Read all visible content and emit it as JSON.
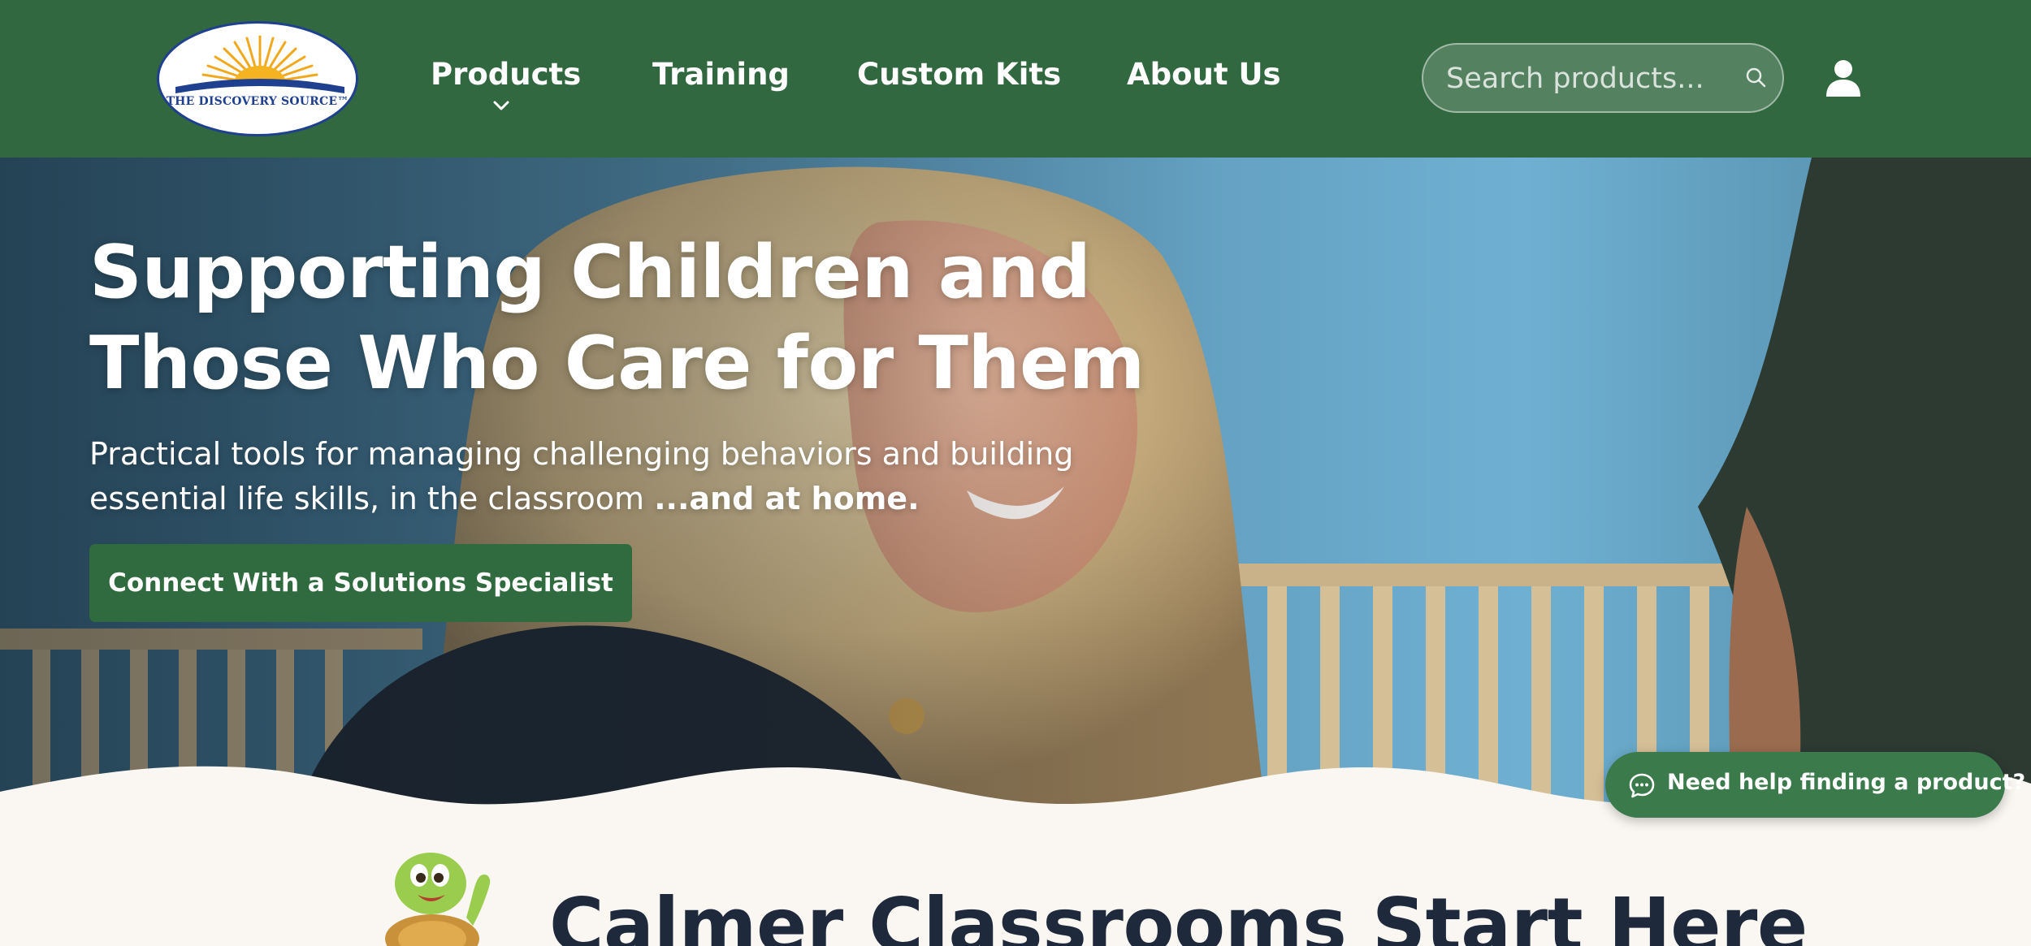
{
  "brand": {
    "logo_text": "THE DISCOVERY SOURCE™",
    "primary_color": "#326840",
    "button_color": "#2f6b3e",
    "logo_blue": "#1f3f8f"
  },
  "nav": {
    "items": [
      {
        "label": "Products"
      },
      {
        "label": "Training"
      },
      {
        "label": "Custom Kits"
      },
      {
        "label": "About Us"
      }
    ]
  },
  "search": {
    "placeholder": "Search products..."
  },
  "hero": {
    "title_line1": "Supporting Children and",
    "title_line2": "Those Who Care for Them",
    "subtitle_line1": "Practical tools for managing challenging behaviors and building",
    "subtitle_line2": "essential life skills, in the classroom ",
    "subtitle_emphasis": "...and at home.",
    "cta_label": "Connect With a Solutions Specialist"
  },
  "chat": {
    "label": "Need help finding a product?"
  },
  "section": {
    "title": "Calmer Classrooms Start Here"
  },
  "icons": {
    "search": "search-icon",
    "user": "user-icon",
    "chat": "chat-bubble-icon",
    "dropdown": "chevron-down-icon"
  }
}
